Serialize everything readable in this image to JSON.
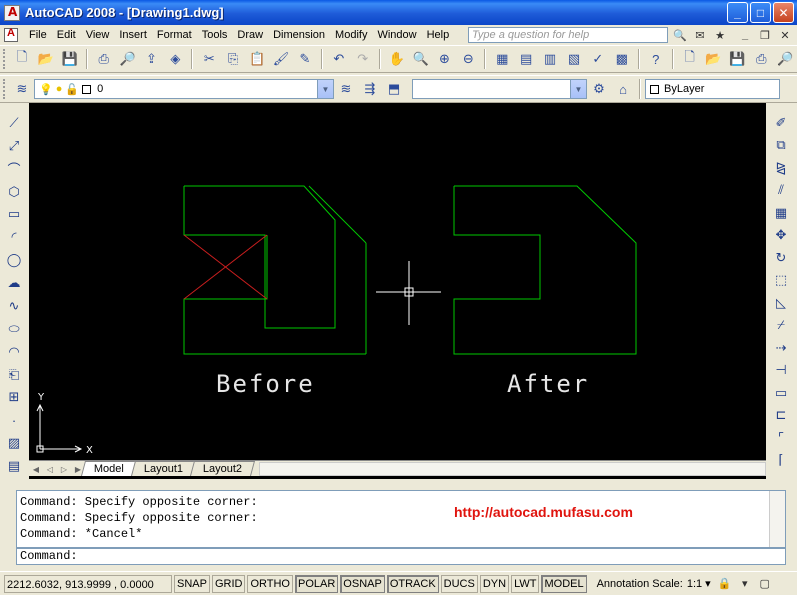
{
  "window": {
    "title": "AutoCAD 2008 - [Drawing1.dwg]",
    "controls": [
      "_",
      "□",
      "✕"
    ]
  },
  "menu": {
    "items": [
      "File",
      "Edit",
      "View",
      "Insert",
      "Format",
      "Tools",
      "Draw",
      "Dimension",
      "Modify",
      "Window",
      "Help"
    ],
    "help_placeholder": "Type a question for help"
  },
  "layer_toolbar": {
    "current_layer": "0"
  },
  "properties_toolbar": {
    "color": "ByLayer"
  },
  "drawing": {
    "labels": {
      "before": "Before",
      "after": "After"
    },
    "ucs": {
      "x": "X",
      "y": "Y"
    },
    "colors": {
      "background": "#000000",
      "outline": "#00C800",
      "cross_lines": "#C81E1E",
      "crosshair": "#FFFFFF",
      "text": "#E6E6E6"
    }
  },
  "layout_tabs": {
    "tabs": [
      "Model",
      "Layout1",
      "Layout2"
    ],
    "active": "Model"
  },
  "command": {
    "history": [
      "Command: Specify opposite corner:",
      "Command: Specify opposite corner:",
      "Command: *Cancel*"
    ],
    "url": "http://autocad.mufasu.com",
    "prompt": "Command:"
  },
  "status": {
    "coordinates": "2212.6032, 913.9999 , 0.0000",
    "toggles": [
      {
        "label": "SNAP",
        "on": false
      },
      {
        "label": "GRID",
        "on": false
      },
      {
        "label": "ORTHO",
        "on": false
      },
      {
        "label": "POLAR",
        "on": true
      },
      {
        "label": "OSNAP",
        "on": true
      },
      {
        "label": "OTRACK",
        "on": true
      },
      {
        "label": "DUCS",
        "on": false
      },
      {
        "label": "DYN",
        "on": false
      },
      {
        "label": "LWT",
        "on": false
      },
      {
        "label": "MODEL",
        "on": true
      }
    ],
    "annotation_label": "Annotation Scale:",
    "annotation_value": "1:1 ▾"
  }
}
